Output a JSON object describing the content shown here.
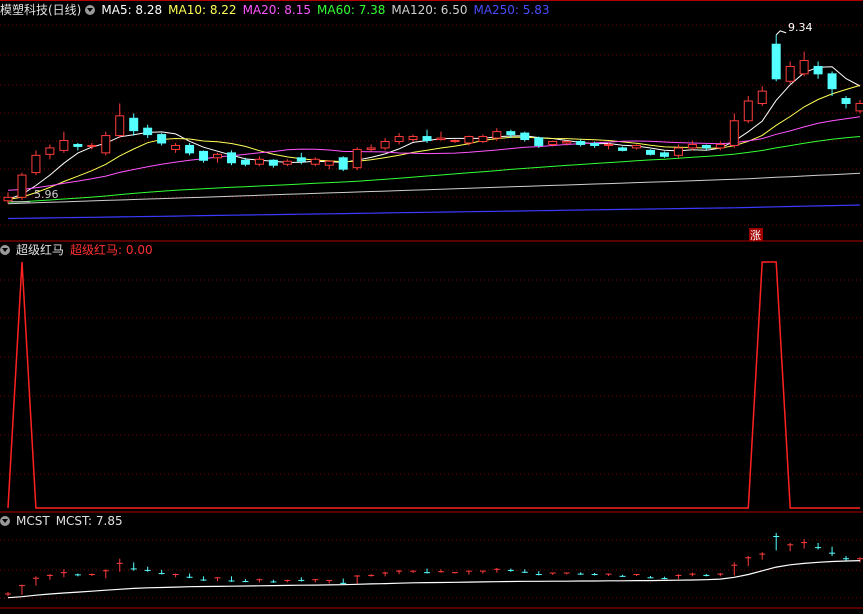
{
  "main_legend": {
    "title": "模塑科技(日线)",
    "ma5": "MA5: 8.28",
    "ma10": "MA10: 8.22",
    "ma20": "MA20: 8.15",
    "ma60": "MA60: 7.38",
    "ma120": "MA120: 6.50",
    "ma250": "MA250: 5.83"
  },
  "ind_legend": {
    "name": "超级红马",
    "value_label": "超级红马: 0.00"
  },
  "mcst_legend": {
    "name": "MCST",
    "value_label": "MCST: 7.85"
  },
  "annotations": {
    "high": "9.34",
    "low": "5.96",
    "badge": "涨"
  },
  "colors": {
    "up": "#ff3c3c",
    "down": "#54ffff",
    "ma5": "#ffffff",
    "ma10": "#ffff55",
    "ma20": "#ff55ff",
    "ma60": "#33ff33",
    "ma120": "#cfcfcf",
    "ma250": "#3a3aff",
    "grid": "#7a0000",
    "signal": "#ff2222"
  },
  "chart_data": {
    "type": "candlestick",
    "price_range": [
      5.55,
      9.6
    ],
    "candles": [
      {
        "o": 5.98,
        "c": 6.05,
        "h": 6.15,
        "l": 5.92,
        "up": true
      },
      {
        "o": 6.05,
        "c": 6.5,
        "h": 6.55,
        "l": 6.0,
        "up": true
      },
      {
        "o": 6.55,
        "c": 6.9,
        "h": 7.0,
        "l": 6.5,
        "up": true
      },
      {
        "o": 6.92,
        "c": 7.05,
        "h": 7.12,
        "l": 6.82,
        "up": true
      },
      {
        "o": 7.0,
        "c": 7.2,
        "h": 7.38,
        "l": 6.95,
        "up": true
      },
      {
        "o": 7.12,
        "c": 7.08,
        "h": 7.15,
        "l": 7.0,
        "up": false
      },
      {
        "o": 7.08,
        "c": 7.1,
        "h": 7.15,
        "l": 7.02,
        "up": true
      },
      {
        "o": 6.95,
        "c": 7.3,
        "h": 7.38,
        "l": 6.9,
        "up": true
      },
      {
        "o": 7.3,
        "c": 7.7,
        "h": 7.95,
        "l": 7.25,
        "up": true
      },
      {
        "o": 7.65,
        "c": 7.4,
        "h": 7.75,
        "l": 7.3,
        "up": false
      },
      {
        "o": 7.45,
        "c": 7.32,
        "h": 7.52,
        "l": 7.25,
        "up": false
      },
      {
        "o": 7.32,
        "c": 7.15,
        "h": 7.35,
        "l": 7.1,
        "up": false
      },
      {
        "o": 7.02,
        "c": 7.1,
        "h": 7.15,
        "l": 6.95,
        "up": true
      },
      {
        "o": 7.1,
        "c": 6.95,
        "h": 7.15,
        "l": 6.9,
        "up": false
      },
      {
        "o": 6.98,
        "c": 6.8,
        "h": 7.0,
        "l": 6.75,
        "up": false
      },
      {
        "o": 6.85,
        "c": 6.92,
        "h": 6.95,
        "l": 6.75,
        "up": true
      },
      {
        "o": 6.95,
        "c": 6.75,
        "h": 7.0,
        "l": 6.7,
        "up": false
      },
      {
        "o": 6.8,
        "c": 6.72,
        "h": 6.85,
        "l": 6.68,
        "up": false
      },
      {
        "o": 6.72,
        "c": 6.82,
        "h": 6.88,
        "l": 6.68,
        "up": true
      },
      {
        "o": 6.8,
        "c": 6.7,
        "h": 6.82,
        "l": 6.65,
        "up": false
      },
      {
        "o": 6.72,
        "c": 6.78,
        "h": 6.82,
        "l": 6.68,
        "up": true
      },
      {
        "o": 6.85,
        "c": 6.78,
        "h": 6.95,
        "l": 6.72,
        "up": false
      },
      {
        "o": 6.72,
        "c": 6.82,
        "h": 6.86,
        "l": 6.68,
        "up": true
      },
      {
        "o": 6.7,
        "c": 6.78,
        "h": 6.8,
        "l": 6.62,
        "up": true
      },
      {
        "o": 6.85,
        "c": 6.62,
        "h": 6.88,
        "l": 6.58,
        "up": false
      },
      {
        "o": 6.65,
        "c": 7.02,
        "h": 7.06,
        "l": 6.6,
        "up": true
      },
      {
        "o": 7.02,
        "c": 7.05,
        "h": 7.12,
        "l": 6.98,
        "up": true
      },
      {
        "o": 7.05,
        "c": 7.18,
        "h": 7.25,
        "l": 7.0,
        "up": true
      },
      {
        "o": 7.18,
        "c": 7.28,
        "h": 7.35,
        "l": 7.12,
        "up": true
      },
      {
        "o": 7.22,
        "c": 7.28,
        "h": 7.32,
        "l": 7.18,
        "up": true
      },
      {
        "o": 7.28,
        "c": 7.2,
        "h": 7.42,
        "l": 7.15,
        "up": false
      },
      {
        "o": 7.22,
        "c": 7.25,
        "h": 7.38,
        "l": 7.2,
        "up": true
      },
      {
        "o": 7.18,
        "c": 7.2,
        "h": 7.22,
        "l": 7.15,
        "up": true
      },
      {
        "o": 7.15,
        "c": 7.28,
        "h": 7.3,
        "l": 7.1,
        "up": true
      },
      {
        "o": 7.18,
        "c": 7.28,
        "h": 7.32,
        "l": 7.15,
        "up": true
      },
      {
        "o": 7.25,
        "c": 7.38,
        "h": 7.45,
        "l": 7.2,
        "up": true
      },
      {
        "o": 7.38,
        "c": 7.32,
        "h": 7.42,
        "l": 7.25,
        "up": false
      },
      {
        "o": 7.35,
        "c": 7.22,
        "h": 7.38,
        "l": 7.18,
        "up": false
      },
      {
        "o": 7.25,
        "c": 7.1,
        "h": 7.28,
        "l": 7.05,
        "up": false
      },
      {
        "o": 7.12,
        "c": 7.18,
        "h": 7.2,
        "l": 7.08,
        "up": true
      },
      {
        "o": 7.15,
        "c": 7.18,
        "h": 7.2,
        "l": 7.1,
        "up": true
      },
      {
        "o": 7.18,
        "c": 7.12,
        "h": 7.22,
        "l": 7.08,
        "up": false
      },
      {
        "o": 7.14,
        "c": 7.1,
        "h": 7.18,
        "l": 7.05,
        "up": false
      },
      {
        "o": 7.1,
        "c": 7.12,
        "h": 7.15,
        "l": 7.02,
        "up": true
      },
      {
        "o": 7.05,
        "c": 7.0,
        "h": 7.08,
        "l": 6.98,
        "up": false
      },
      {
        "o": 7.05,
        "c": 7.1,
        "h": 7.12,
        "l": 7.02,
        "up": true
      },
      {
        "o": 7.0,
        "c": 6.92,
        "h": 7.02,
        "l": 6.9,
        "up": false
      },
      {
        "o": 6.95,
        "c": 6.88,
        "h": 6.98,
        "l": 6.85,
        "up": false
      },
      {
        "o": 6.9,
        "c": 7.05,
        "h": 7.12,
        "l": 6.85,
        "up": true
      },
      {
        "o": 7.05,
        "c": 7.12,
        "h": 7.2,
        "l": 7.0,
        "up": true
      },
      {
        "o": 7.1,
        "c": 7.05,
        "h": 7.12,
        "l": 7.0,
        "up": false
      },
      {
        "o": 7.05,
        "c": 7.12,
        "h": 7.18,
        "l": 7.0,
        "up": true
      },
      {
        "o": 7.1,
        "c": 7.6,
        "h": 7.75,
        "l": 7.05,
        "up": true
      },
      {
        "o": 7.6,
        "c": 8.0,
        "h": 8.1,
        "l": 7.55,
        "up": true
      },
      {
        "o": 7.95,
        "c": 8.2,
        "h": 8.3,
        "l": 7.9,
        "up": true
      },
      {
        "o": 8.45,
        "c": 9.15,
        "h": 9.34,
        "l": 8.4,
        "up": false
      },
      {
        "o": 8.4,
        "c": 8.7,
        "h": 8.8,
        "l": 8.35,
        "up": true
      },
      {
        "o": 8.55,
        "c": 8.82,
        "h": 9.0,
        "l": 8.5,
        "up": true
      },
      {
        "o": 8.7,
        "c": 8.55,
        "h": 8.8,
        "l": 8.45,
        "up": false
      },
      {
        "o": 8.55,
        "c": 8.25,
        "h": 8.6,
        "l": 8.1,
        "up": false
      },
      {
        "o": 8.05,
        "c": 7.95,
        "h": 8.1,
        "l": 7.85,
        "up": false
      },
      {
        "o": 7.8,
        "c": 7.95,
        "h": 8.02,
        "l": 7.75,
        "up": true
      }
    ],
    "signal": [
      0,
      1,
      0,
      0,
      0,
      0,
      0,
      0,
      0,
      0,
      0,
      0,
      0,
      0,
      0,
      0,
      0,
      0,
      0,
      0,
      0,
      0,
      0,
      0,
      0,
      0,
      0,
      0,
      0,
      0,
      0,
      0,
      0,
      0,
      0,
      0,
      0,
      0,
      0,
      0,
      0,
      0,
      0,
      0,
      0,
      0,
      0,
      0,
      0,
      0,
      0,
      0,
      0,
      0,
      1,
      1,
      0,
      0,
      0,
      0,
      0,
      0
    ],
    "mcst_line": [
      5.85,
      5.9,
      5.98,
      6.05,
      6.1,
      6.15,
      6.2,
      6.25,
      6.3,
      6.35,
      6.38,
      6.4,
      6.42,
      6.44,
      6.45,
      6.46,
      6.47,
      6.48,
      6.49,
      6.5,
      6.51,
      6.52,
      6.53,
      6.54,
      6.55,
      6.57,
      6.59,
      6.61,
      6.63,
      6.65,
      6.66,
      6.67,
      6.68,
      6.69,
      6.7,
      6.71,
      6.72,
      6.73,
      6.73,
      6.74,
      6.74,
      6.75,
      6.75,
      6.76,
      6.76,
      6.77,
      6.77,
      6.78,
      6.79,
      6.8,
      6.82,
      6.85,
      6.95,
      7.1,
      7.3,
      7.5,
      7.62,
      7.7,
      7.76,
      7.8,
      7.83,
      7.85
    ]
  }
}
